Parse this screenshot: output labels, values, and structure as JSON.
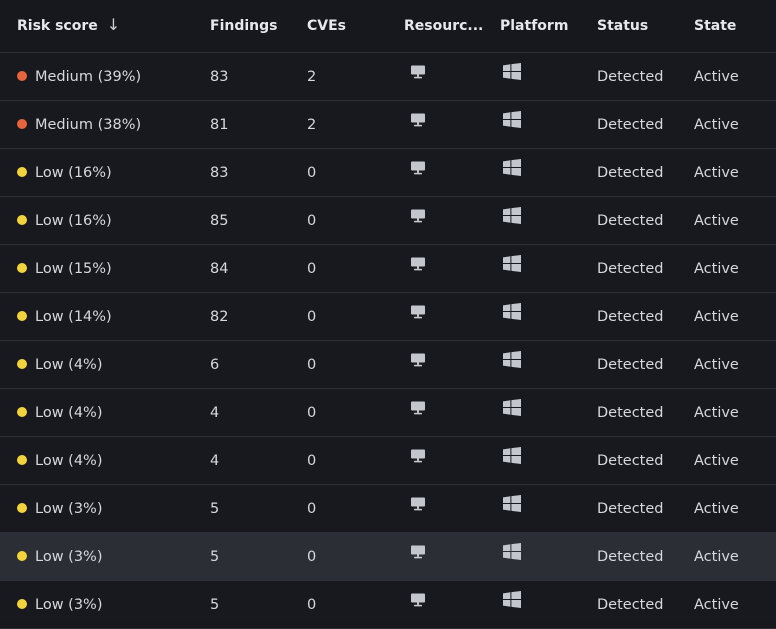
{
  "colors": {
    "medium": "#e8643c",
    "low": "#f2d33c",
    "icon": "#c3c6cc"
  },
  "header": {
    "risk_score": "Risk score",
    "sort_icon": "arrow-down-icon",
    "sort_glyph": "↓",
    "findings": "Findings",
    "cves": "CVEs",
    "resource": "Resourc...",
    "platform": "Platform",
    "status": "Status",
    "state": "State"
  },
  "rows": [
    {
      "severity": "medium",
      "risk": "Medium (39%)",
      "findings": "83",
      "cves": "2",
      "resource_icon": "monitor-icon",
      "platform_icon": "windows-icon",
      "status": "Detected",
      "state": "Active"
    },
    {
      "severity": "medium",
      "risk": "Medium (38%)",
      "findings": "81",
      "cves": "2",
      "resource_icon": "monitor-icon",
      "platform_icon": "windows-icon",
      "status": "Detected",
      "state": "Active"
    },
    {
      "severity": "low",
      "risk": "Low (16%)",
      "findings": "83",
      "cves": "0",
      "resource_icon": "monitor-icon",
      "platform_icon": "windows-icon",
      "status": "Detected",
      "state": "Active"
    },
    {
      "severity": "low",
      "risk": "Low (16%)",
      "findings": "85",
      "cves": "0",
      "resource_icon": "monitor-icon",
      "platform_icon": "windows-icon",
      "status": "Detected",
      "state": "Active"
    },
    {
      "severity": "low",
      "risk": "Low (15%)",
      "findings": "84",
      "cves": "0",
      "resource_icon": "monitor-icon",
      "platform_icon": "windows-icon",
      "status": "Detected",
      "state": "Active"
    },
    {
      "severity": "low",
      "risk": "Low (14%)",
      "findings": "82",
      "cves": "0",
      "resource_icon": "monitor-icon",
      "platform_icon": "windows-icon",
      "status": "Detected",
      "state": "Active"
    },
    {
      "severity": "low",
      "risk": "Low (4%)",
      "findings": "6",
      "cves": "0",
      "resource_icon": "monitor-icon",
      "platform_icon": "windows-icon",
      "status": "Detected",
      "state": "Active"
    },
    {
      "severity": "low",
      "risk": "Low (4%)",
      "findings": "4",
      "cves": "0",
      "resource_icon": "monitor-icon",
      "platform_icon": "windows-icon",
      "status": "Detected",
      "state": "Active"
    },
    {
      "severity": "low",
      "risk": "Low (4%)",
      "findings": "4",
      "cves": "0",
      "resource_icon": "monitor-icon",
      "platform_icon": "windows-icon",
      "status": "Detected",
      "state": "Active"
    },
    {
      "severity": "low",
      "risk": "Low (3%)",
      "findings": "5",
      "cves": "0",
      "resource_icon": "monitor-icon",
      "platform_icon": "windows-icon",
      "status": "Detected",
      "state": "Active"
    },
    {
      "severity": "low",
      "risk": "Low (3%)",
      "findings": "5",
      "cves": "0",
      "resource_icon": "monitor-icon",
      "platform_icon": "windows-icon",
      "status": "Detected",
      "state": "Active",
      "hovered": true
    },
    {
      "severity": "low",
      "risk": "Low (3%)",
      "findings": "5",
      "cves": "0",
      "resource_icon": "monitor-icon",
      "platform_icon": "windows-icon",
      "status": "Detected",
      "state": "Active"
    }
  ]
}
